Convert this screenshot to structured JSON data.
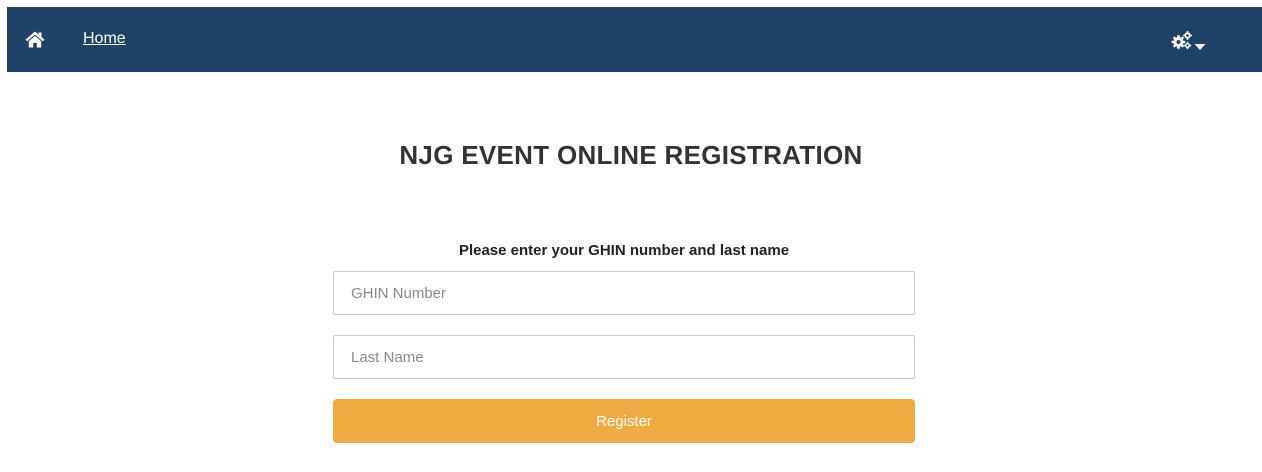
{
  "nav": {
    "home_icon": "home-icon",
    "home_label": "Home",
    "settings_icon": "gears-icon",
    "settings_caret": "caret-down-icon",
    "background_color": "#204264"
  },
  "main": {
    "title": "NJG EVENT ONLINE REGISTRATION",
    "instructions": "Please enter your GHIN number and last name",
    "ghin_field": {
      "value": "",
      "placeholder": "GHIN Number"
    },
    "last_name_field": {
      "value": "",
      "placeholder": "Last Name"
    },
    "register_label": "Register",
    "register_color": "#f0aa42"
  }
}
